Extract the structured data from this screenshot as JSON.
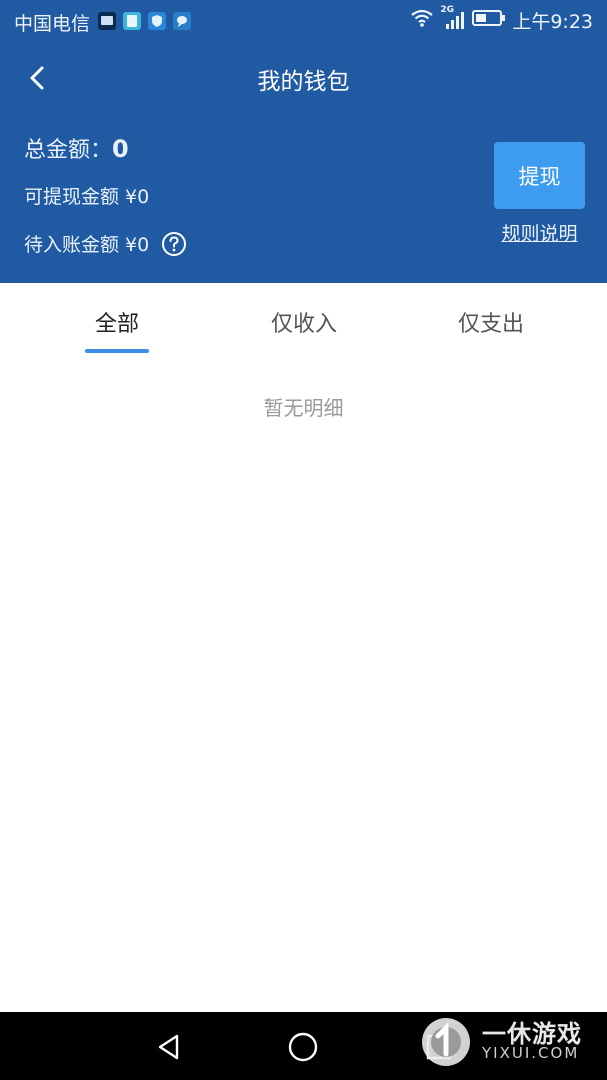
{
  "status_bar": {
    "carrier": "中国电信",
    "network": "2G",
    "time": "上午9:23"
  },
  "header": {
    "title": "我的钱包",
    "total_label": "总金额：",
    "total_value": "0",
    "withdrawable_label": "可提现金额 ¥0",
    "pending_label": "待入账金额 ¥0",
    "withdraw_button": "提现",
    "rules_link": "规则说明"
  },
  "tabs": [
    {
      "label": "全部",
      "active": true
    },
    {
      "label": "仅收入",
      "active": false
    },
    {
      "label": "仅支出",
      "active": false
    }
  ],
  "empty_state": "暂无明细",
  "watermark": {
    "text": "一休游戏",
    "sub": "YIXUI.COM"
  },
  "colors": {
    "header_bg": "#1f5aa3",
    "button_bg": "#3d9bf0",
    "tab_indicator": "#3d8fe6",
    "empty_text": "#9a9a9a"
  }
}
